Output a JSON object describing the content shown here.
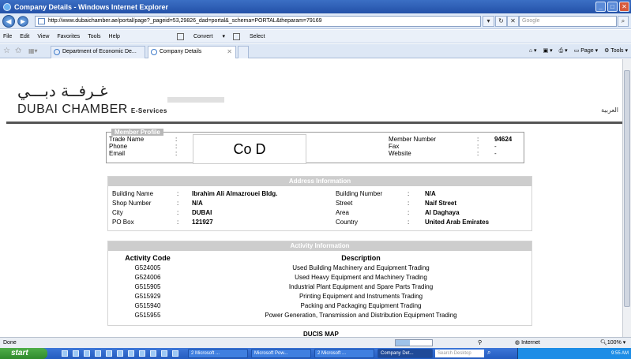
{
  "window": {
    "title": "Company Details - Windows Internet Explorer"
  },
  "addressbar": {
    "url": "http://www.dubaichamber.ae/portal/page?_pageid=53,29826_dad=portal&_schema=PORTAL&theparam=79169",
    "search_placeholder": "Google"
  },
  "menubar": {
    "items": [
      "File",
      "Edit",
      "View",
      "Favorites",
      "Tools",
      "Help"
    ],
    "convert_label": "Convert",
    "select_label": "Select"
  },
  "tabs": [
    {
      "label": "Department of Economic De..."
    },
    {
      "label": "Company Details"
    }
  ],
  "cmdbar": {
    "page_label": "Page",
    "tools_label": "Tools"
  },
  "header": {
    "logo_arabic": "غـرفــة دبـــي",
    "logo_english": "DUBAI CHAMBER",
    "logo_suffix": "E-Services",
    "arabic_link": "العربية"
  },
  "profile": {
    "legend": "Member Profile",
    "left": [
      {
        "label": "Trade Name",
        "sep": ":",
        "value": ""
      },
      {
        "label": "Phone",
        "sep": ":",
        "value": ""
      },
      {
        "label": "Email",
        "sep": ":",
        "value": ""
      }
    ],
    "right": [
      {
        "label": "Member Number",
        "sep": ":",
        "value": "94624"
      },
      {
        "label": "Fax",
        "sep": ":",
        "value": "-"
      },
      {
        "label": "Website",
        "sep": ":",
        "value": "-"
      }
    ],
    "overlay_text": "Co D"
  },
  "address": {
    "title": "Address Information",
    "rows": [
      {
        "l_label": "Building Name",
        "l_value": "Ibrahim Ali Almazrouei Bldg.",
        "r_label": "Building Number",
        "r_value": "N/A"
      },
      {
        "l_label": "Shop Number",
        "l_value": "N/A",
        "r_label": "Street",
        "r_value": "Naif Street"
      },
      {
        "l_label": "City",
        "l_value": "DUBAI",
        "r_label": "Area",
        "r_value": "Al Daghaya"
      },
      {
        "l_label": "PO Box",
        "l_value": "121927",
        "r_label": "Country",
        "r_value": "United Arab Emirates"
      }
    ],
    "sep": ":"
  },
  "activity": {
    "title": "Activity Information",
    "col_code": "Activity Code",
    "col_desc": "Description",
    "rows": [
      {
        "code": "G524005",
        "desc": "Used Building Machinery and Equipment Trading"
      },
      {
        "code": "G524006",
        "desc": "Used Heavy Equipment and Machinery Trading"
      },
      {
        "code": "G515905",
        "desc": "Industrial Plant Equipment and Spare Parts Trading"
      },
      {
        "code": "G515929",
        "desc": "Printing Equipment and Instruments Trading"
      },
      {
        "code": "G515940",
        "desc": "Packing and Packaging Equipment Trading"
      },
      {
        "code": "G515955",
        "desc": "Power Generation, Transmission and Distribution Equipment Trading"
      }
    ],
    "next_section": "DUCIS MAP"
  },
  "statusbar": {
    "left": "Done",
    "zone": "Internet",
    "zoom": "100%",
    "progress": 0.4
  },
  "taskbar": {
    "start": "start",
    "items": [
      "2 Microsoft ...",
      "Microsoft Pow...",
      "2 Microsoft ...",
      "Company Det..."
    ],
    "search": "Search Desktop",
    "clock": "9:55 AM"
  }
}
